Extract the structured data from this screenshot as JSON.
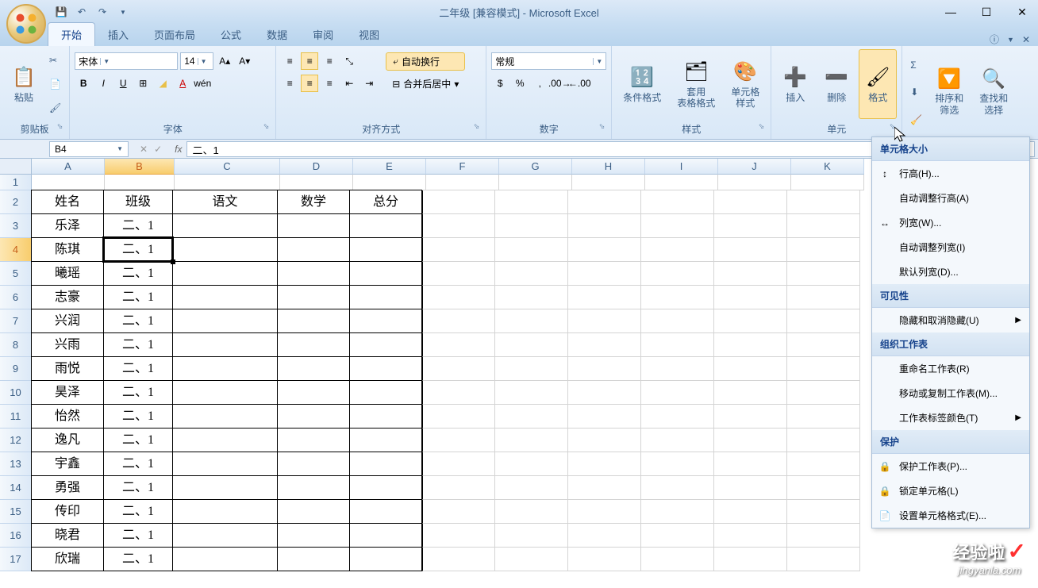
{
  "window": {
    "title": "二年级  [兼容模式] - Microsoft Excel"
  },
  "tabs": [
    "开始",
    "插入",
    "页面布局",
    "公式",
    "数据",
    "审阅",
    "视图"
  ],
  "active_tab_index": 0,
  "ribbon": {
    "clipboard": {
      "label": "剪贴板",
      "paste": "粘贴"
    },
    "font": {
      "label": "字体",
      "name": "宋体",
      "size": "14"
    },
    "alignment": {
      "label": "对齐方式",
      "wrap": "自动换行",
      "merge": "合并后居中"
    },
    "number": {
      "label": "数字",
      "format": "常规"
    },
    "styles": {
      "label": "样式",
      "conditional": "条件格式",
      "table": "套用\n表格格式",
      "cell": "单元格\n样式"
    },
    "cells": {
      "label": "单元",
      "insert": "插入",
      "delete": "删除",
      "format": "格式"
    },
    "editing": {
      "label": "",
      "sort": "排序和\n筛选",
      "find": "查找和\n选择"
    }
  },
  "formula_bar": {
    "name_box": "B4",
    "formula": "二、1"
  },
  "columns": [
    "A",
    "B",
    "C",
    "D",
    "E",
    "F",
    "G",
    "H",
    "I",
    "J",
    "K"
  ],
  "active_col_index": 1,
  "rows": [
    1,
    2,
    3,
    4,
    5,
    6,
    7,
    8,
    9,
    10,
    11,
    12,
    13,
    14,
    15,
    16,
    17
  ],
  "active_row_index": 3,
  "table": {
    "headers": [
      "姓名",
      "班级",
      "语文",
      "数学",
      "总分"
    ],
    "rows": [
      [
        "乐泽",
        "二、1",
        "",
        "",
        ""
      ],
      [
        "陈琪",
        "二、1",
        "",
        "",
        ""
      ],
      [
        "曦瑶",
        "二、1",
        "",
        "",
        ""
      ],
      [
        "志豪",
        "二、1",
        "",
        "",
        ""
      ],
      [
        "兴润",
        "二、1",
        "",
        "",
        ""
      ],
      [
        "兴雨",
        "二、1",
        "",
        "",
        ""
      ],
      [
        "雨悦",
        "二、1",
        "",
        "",
        ""
      ],
      [
        "昊泽",
        "二、1",
        "",
        "",
        ""
      ],
      [
        "怡然",
        "二、1",
        "",
        "",
        ""
      ],
      [
        "逸凡",
        "二、1",
        "",
        "",
        ""
      ],
      [
        "宇鑫",
        "二、1",
        "",
        "",
        ""
      ],
      [
        "勇强",
        "二、1",
        "",
        "",
        ""
      ],
      [
        "传印",
        "二、1",
        "",
        "",
        ""
      ],
      [
        "晓君",
        "二、1",
        "",
        "",
        ""
      ],
      [
        "欣瑞",
        "二、1",
        "",
        "",
        ""
      ]
    ]
  },
  "dropdown": {
    "sections": [
      {
        "title": "单元格大小",
        "items": [
          {
            "label": "行高(H)...",
            "icon": "↕"
          },
          {
            "label": "自动调整行高(A)",
            "icon": ""
          },
          {
            "label": "列宽(W)...",
            "icon": "↔"
          },
          {
            "label": "自动调整列宽(I)",
            "icon": ""
          },
          {
            "label": "默认列宽(D)...",
            "icon": ""
          }
        ]
      },
      {
        "title": "可见性",
        "items": [
          {
            "label": "隐藏和取消隐藏(U)",
            "icon": "",
            "arrow": "▶"
          }
        ]
      },
      {
        "title": "组织工作表",
        "items": [
          {
            "label": "重命名工作表(R)",
            "icon": ""
          },
          {
            "label": "移动或复制工作表(M)...",
            "icon": ""
          },
          {
            "label": "工作表标签颜色(T)",
            "icon": "",
            "arrow": "▶"
          }
        ]
      },
      {
        "title": "保护",
        "items": [
          {
            "label": "保护工作表(P)...",
            "icon": "🔒"
          },
          {
            "label": "锁定单元格(L)",
            "icon": "🔒"
          },
          {
            "label": "设置单元格格式(E)...",
            "icon": "📄"
          }
        ]
      }
    ]
  },
  "watermark": {
    "cn": "经验啦",
    "en": "jingyanla.com"
  }
}
